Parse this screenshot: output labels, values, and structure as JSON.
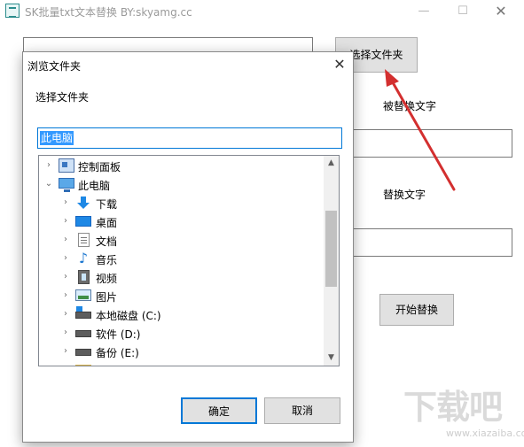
{
  "main_window": {
    "title": "SK批量txt文本替换 BY:skyamg.cc",
    "choose_folder_button": "选择文件夹",
    "find_label": "被替换文字",
    "replace_label": "替换文字",
    "start_button": "开始替换",
    "controls": {
      "minimize": "—",
      "maximize": "☐",
      "close": "✕"
    }
  },
  "dialog": {
    "title": "浏览文件夹",
    "close": "✕",
    "prompt": "选择文件夹",
    "path_value": "此电脑",
    "tree": [
      {
        "label": "控制面板",
        "icon": "control-panel-icon",
        "expander": "›"
      },
      {
        "label": "此电脑",
        "icon": "computer-icon",
        "expander": "⌄"
      },
      {
        "label": "下载",
        "icon": "download-icon",
        "expander": "›"
      },
      {
        "label": "桌面",
        "icon": "desktop-icon",
        "expander": "›"
      },
      {
        "label": "文档",
        "icon": "document-icon",
        "expander": "›"
      },
      {
        "label": "音乐",
        "icon": "music-icon",
        "expander": "›"
      },
      {
        "label": "视频",
        "icon": "video-icon",
        "expander": "›"
      },
      {
        "label": "图片",
        "icon": "picture-icon",
        "expander": "›"
      },
      {
        "label": "本地磁盘 (C:)",
        "icon": "system-drive-icon",
        "expander": "›"
      },
      {
        "label": "软件 (D:)",
        "icon": "drive-icon",
        "expander": "›"
      },
      {
        "label": "备份 (E:)",
        "icon": "drive-icon",
        "expander": "›"
      }
    ],
    "ok_button": "确定",
    "cancel_button": "取消"
  },
  "watermark": {
    "text": "下载吧",
    "url": "www.xiazaiba.com"
  },
  "colors": {
    "selection": "#3399ff",
    "focus_border": "#0078d7",
    "arrow": "#d32f2f"
  }
}
